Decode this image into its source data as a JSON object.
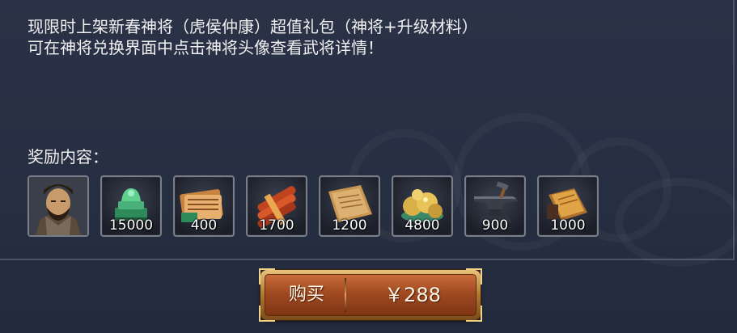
{
  "description": {
    "line1": "现限时上架新春神将（虎侯仲康）超值礼包（神将+升级材料）",
    "line2": "可在神将兑换界面中点击神将头像查看武将详情！"
  },
  "rewards": {
    "label": "奖励内容：",
    "items": [
      {
        "icon": "general-portrait-icon",
        "qty": ""
      },
      {
        "icon": "jade-seal-icon",
        "qty": "15000"
      },
      {
        "icon": "scroll-bundle-icon",
        "qty": "400"
      },
      {
        "icon": "red-scrolls-icon",
        "qty": "1700"
      },
      {
        "icon": "parchment-icon",
        "qty": "1200"
      },
      {
        "icon": "gold-ore-icon",
        "qty": "4800"
      },
      {
        "icon": "anvil-icon",
        "qty": "900"
      },
      {
        "icon": "manual-book-icon",
        "qty": "1000"
      }
    ]
  },
  "purchase": {
    "buy_label": "购买",
    "price": "￥288"
  },
  "colors": {
    "panel_bg": "#262e42",
    "button_orange": "#a04a22",
    "button_gold_rim": "#e8c27a",
    "text": "#f1f1f1"
  }
}
